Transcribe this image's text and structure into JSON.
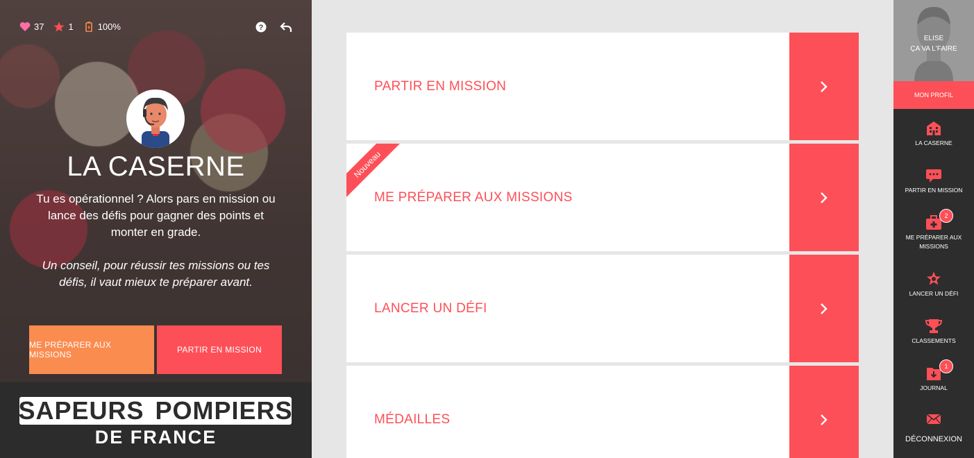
{
  "stats": {
    "hearts": "37",
    "stars": "1",
    "battery": "100%"
  },
  "left": {
    "title": "LA CASERNE",
    "description": "Tu es opérationnel ? Alors pars en mission ou lance des défis pour gagner des points et monter en grade.",
    "tip": "Un conseil, pour réussir tes missions ou tes défis, il vaut mieux te préparer avant.",
    "btn_prepare": "ME PRÉPARER AUX MISSIONS",
    "btn_mission": "PARTIR EN MISSION",
    "logo_top_left": "SAPEURS",
    "logo_top_right": "POMPIERS",
    "logo_bottom": "DE FRANCE"
  },
  "cards": [
    {
      "label": "PARTIR EN MISSION"
    },
    {
      "label": "ME PRÉPARER AUX MISSIONS",
      "ribbon": "Nouveau"
    },
    {
      "label": "LANCER UN DÉFI"
    },
    {
      "label": "MÉDAILLES"
    }
  ],
  "sidebar": {
    "name_line1": "ELISE",
    "name_line2": "ÇA VA L'FAIRE",
    "profile_label": "MON PROFIL",
    "items": [
      {
        "label": "LA CASERNE",
        "icon": "house-icon"
      },
      {
        "label": "PARTIR EN MISSION",
        "icon": "chat-icon"
      },
      {
        "label": "ME PRÉPARER AUX MISSIONS",
        "icon": "medkit-icon",
        "badge": "2"
      },
      {
        "label": "LANCER UN DÉFI",
        "icon": "star-badge-icon"
      },
      {
        "label": "CLASSEMENTS",
        "icon": "trophy-icon"
      },
      {
        "label": "JOURNAL",
        "icon": "journal-icon",
        "badge": "1"
      }
    ],
    "logout_label": "DÉCONNEXION"
  },
  "colors": {
    "accent": "#fd4f57",
    "orange": "#fb8c50",
    "dark": "#2d2d2d"
  }
}
